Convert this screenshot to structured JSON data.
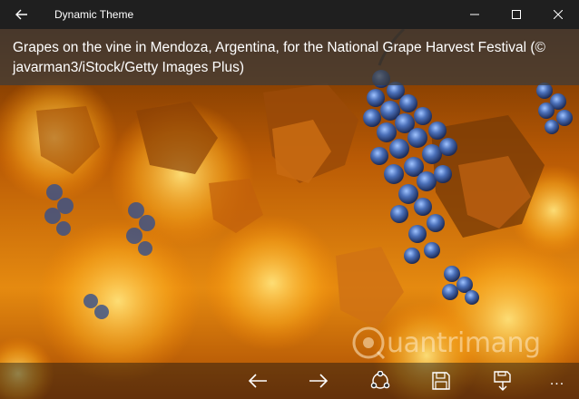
{
  "window": {
    "title": "Dynamic Theme",
    "back_icon": "arrow-left-icon",
    "controls": [
      "minimize-icon",
      "maximize-icon",
      "close-icon"
    ]
  },
  "photo": {
    "caption": "Grapes on the vine in Mendoza, Argentina, for the National Grape Harvest Festival (© javarman3/iStock/Getty Images Plus)"
  },
  "watermark": {
    "text": "uantrimang"
  },
  "commandbar": {
    "buttons": [
      "previous-icon",
      "next-icon",
      "share-icon",
      "save-icon",
      "download-icon",
      "more-icon"
    ],
    "more_label": "..."
  },
  "colors": {
    "titlebar": "#1f1f1f",
    "accent_orange": "#f08a10",
    "grape_blue": "#3e5c9c"
  }
}
